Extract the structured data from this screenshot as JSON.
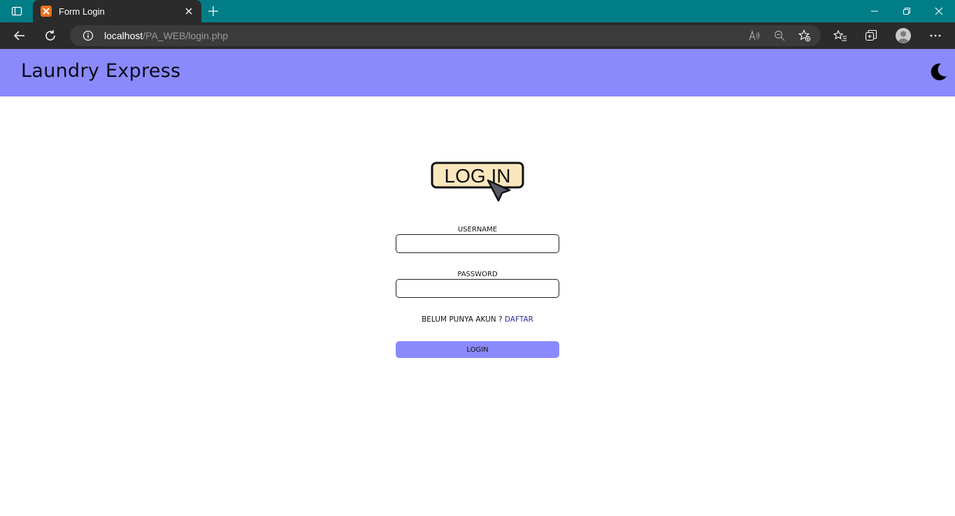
{
  "browser": {
    "tab_title": "Form Login",
    "url_host": "localhost",
    "url_path": "/PA_WEB/login.php"
  },
  "site": {
    "title": "Laundry Express",
    "theme_icon": "moon-icon"
  },
  "login_form": {
    "badge_text": "LOG IN",
    "username_label": "USERNAME",
    "username_value": "",
    "password_label": "PASSWORD",
    "password_value": "",
    "register_prompt": "BELUM PUNYA AKUN ?",
    "register_link": "DAFTAR",
    "submit_label": "LOGIN"
  },
  "colors": {
    "tab_strip": "#017d87",
    "toolbar": "#2b2b2b",
    "header": "#8b8afc",
    "button": "#8b8afc",
    "link": "#2f2fa0",
    "badge_fill": "#fae7bd"
  }
}
